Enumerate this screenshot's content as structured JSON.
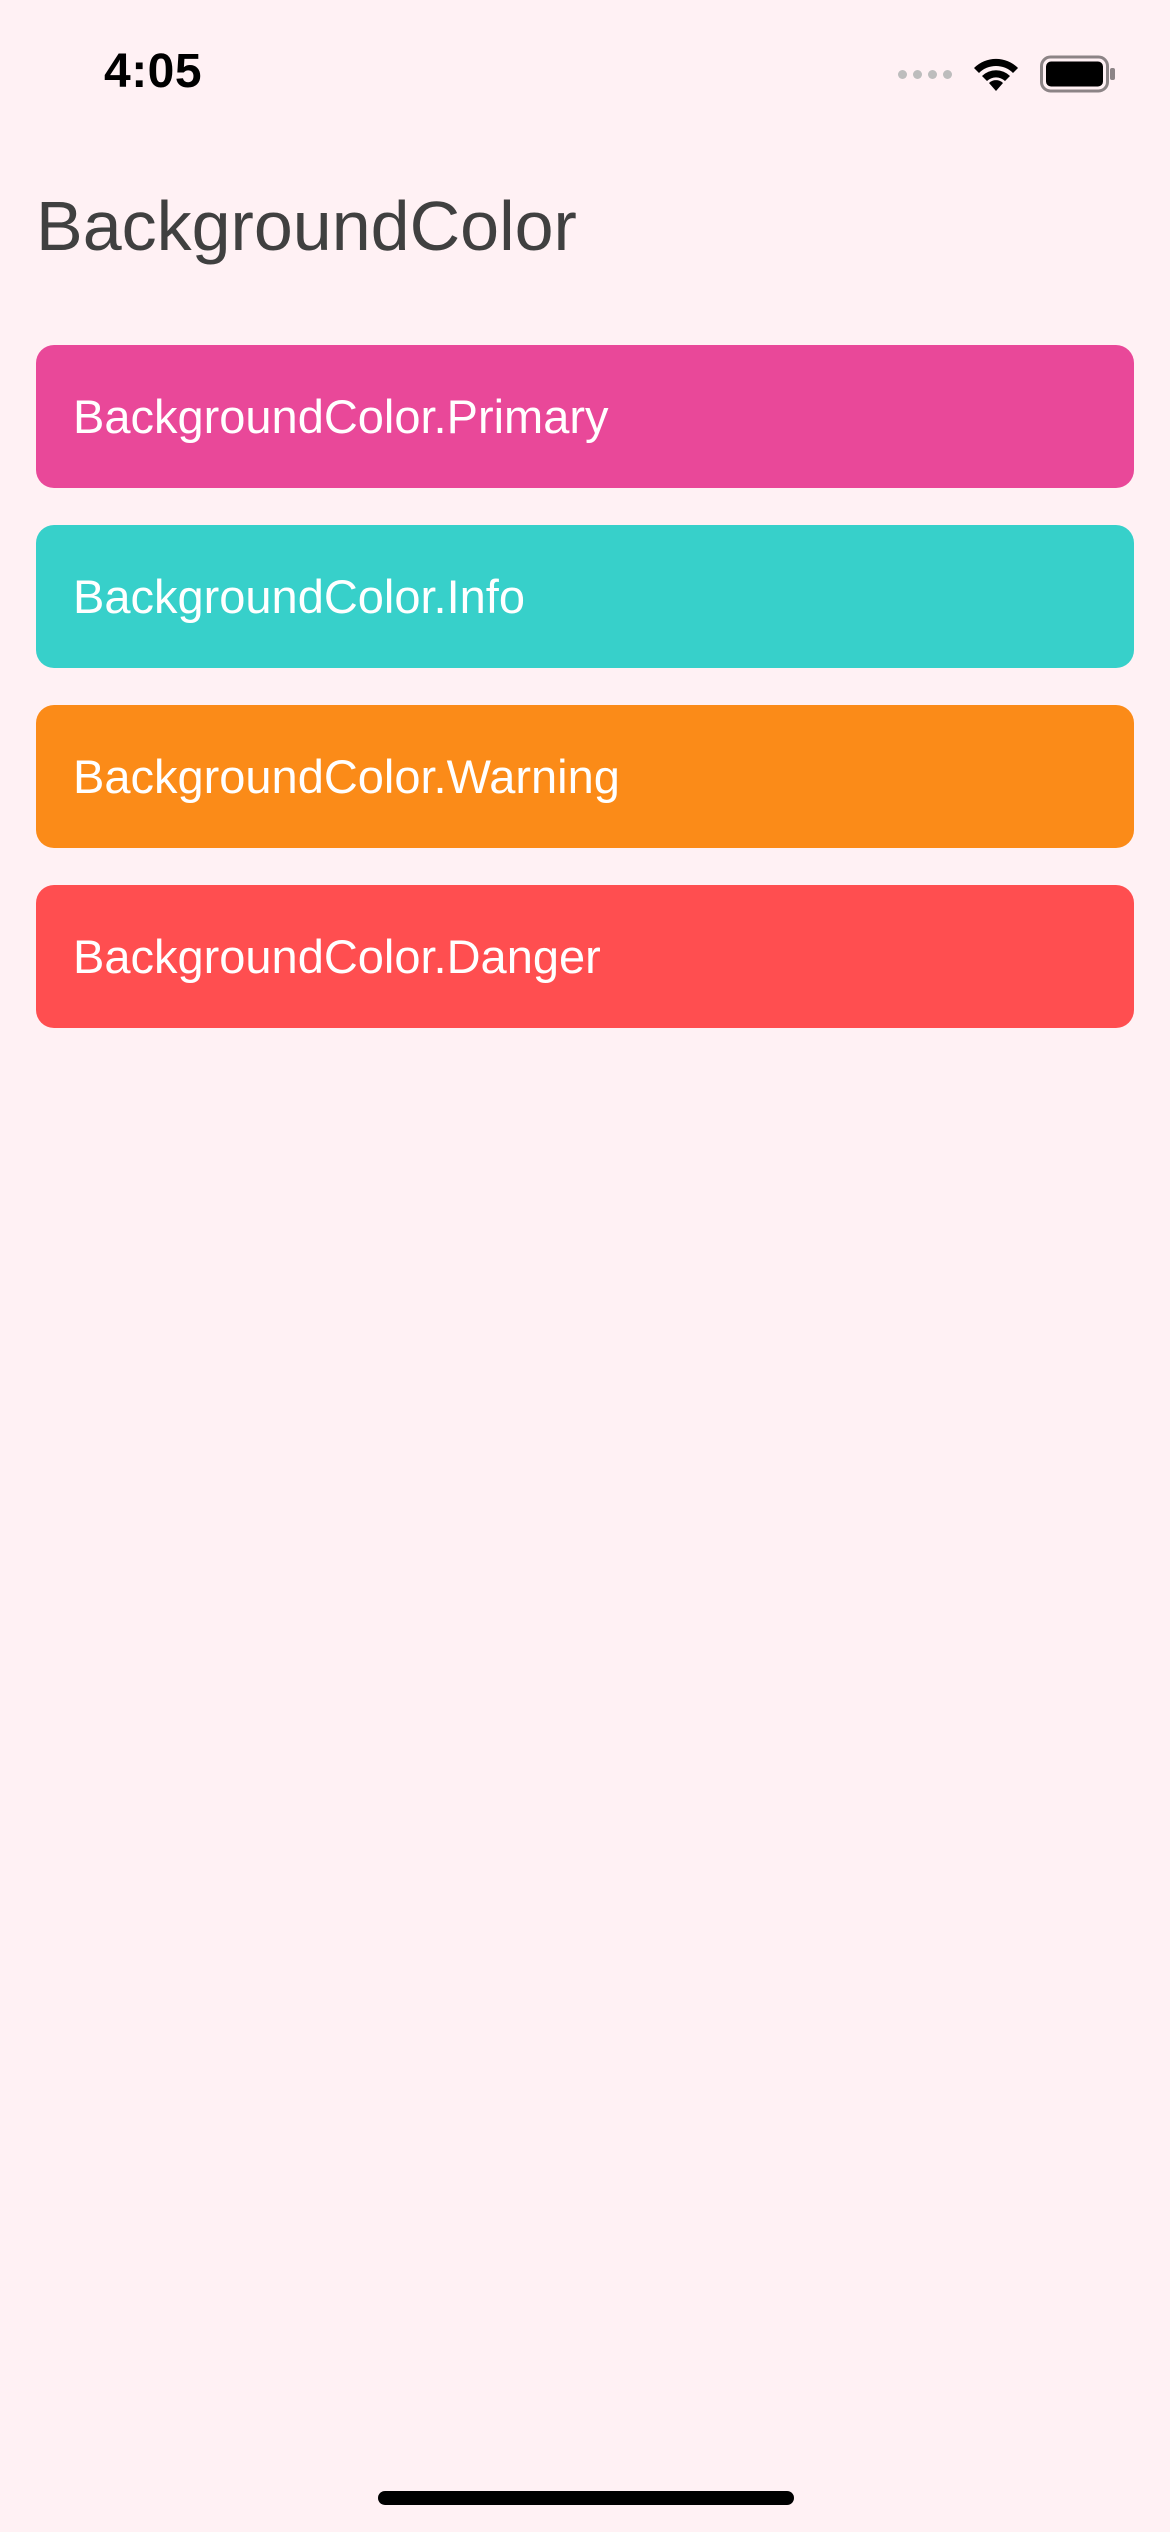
{
  "status_bar": {
    "time": "4:05",
    "signal_icon": "cellular-signal-icon",
    "wifi_icon": "wifi-icon",
    "battery_icon": "battery-icon"
  },
  "page": {
    "title": "BackgroundColor",
    "background": "#FFF1F4"
  },
  "buttons": [
    {
      "label": "BackgroundColor.Primary",
      "color": "#E94899"
    },
    {
      "label": "BackgroundColor.Info",
      "color": "#37D0CA"
    },
    {
      "label": "BackgroundColor.Warning",
      "color": "#FB8B18"
    },
    {
      "label": "BackgroundColor.Danger",
      "color": "#FF4E50"
    }
  ]
}
